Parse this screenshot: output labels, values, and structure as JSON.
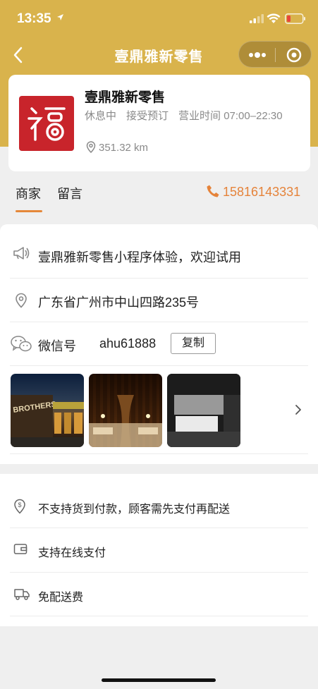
{
  "status_bar": {
    "time": "13:35"
  },
  "nav": {
    "title": "壹鼎雅新零售"
  },
  "store": {
    "name": "壹鼎雅新零售",
    "status": "休息中",
    "booking": "接受预订",
    "hours": "营业时间 07:00–22:30",
    "distance": "351.32 km",
    "logo_color": "#c8242b"
  },
  "tabs": [
    {
      "label": "商家",
      "active": true
    },
    {
      "label": "留言",
      "active": false
    }
  ],
  "phone": "15816143331",
  "info": {
    "announcement": "壹鼎雅新零售小程序体验，欢迎试用",
    "address": "广东省广州市中山四路235号",
    "wechat_label": "微信号",
    "wechat_id": "ahu61888",
    "copy_label": "复制"
  },
  "payment": [
    {
      "icon": "dollar-pin-icon",
      "label": "不支持货到付款，顾客需先支付再配送"
    },
    {
      "icon": "wallet-icon",
      "label": "支持在线支付"
    },
    {
      "icon": "delivery-truck-icon",
      "label": "免配送费"
    }
  ],
  "colors": {
    "header": "#d9b34c",
    "accent": "#e5833a"
  }
}
